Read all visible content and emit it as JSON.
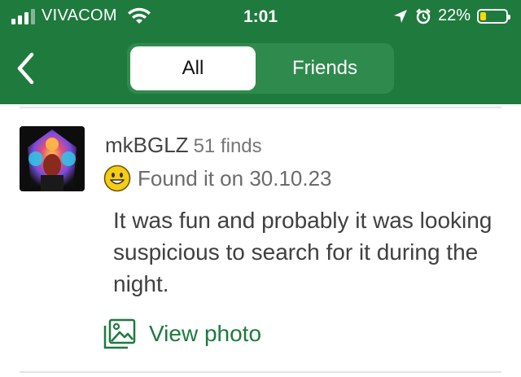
{
  "status_bar": {
    "carrier": "VIVACOM",
    "time": "1:01",
    "battery_percent_text": "22%",
    "battery_level": 0.22,
    "battery_color": "#ffd60a",
    "icons": [
      "signal-icon",
      "wifi-icon",
      "location-arrow-icon",
      "alarm-clock-icon",
      "battery-icon"
    ]
  },
  "nav": {
    "back_icon": "chevron-left-icon",
    "tabs": [
      {
        "label": "All",
        "selected": true
      },
      {
        "label": "Friends",
        "selected": false
      }
    ]
  },
  "log": {
    "username": "mkBGLZ",
    "finds": "51 finds",
    "status_icon": "smiley-found-icon",
    "status_text": "Found it on 30.10.23",
    "text": "It was fun and probably it was looking suspicious to search for it during the night.",
    "view_photo_label": "View photo",
    "view_photo_icon": "photo-icon"
  },
  "colors": {
    "header_green": "#1f7a3e",
    "segment_bg": "#2f8b4d",
    "link_green": "#1d7a3d",
    "smiley_yellow": "#f6cc16"
  }
}
